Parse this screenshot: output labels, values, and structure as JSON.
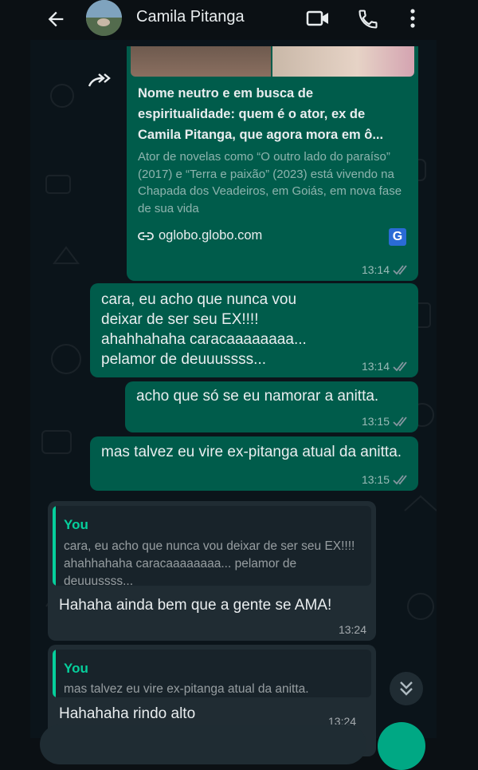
{
  "header": {
    "contact_name": "Camila Pitanga"
  },
  "messages": {
    "link": {
      "title": "Nome neutro e em busca de espiritualidade: quem é o ator, ex de Camila Pitanga, que agora mora em ô...",
      "description": "Ator de novelas como “O outro lado do paraíso” (2017) e “Terra e paixão” (2023) está vivendo na Chapada dos Veadeiros, em Goiás, em nova fase de sua vida",
      "domain": "oglobo.globo.com",
      "badge": "G",
      "time": "13:14"
    },
    "m1": {
      "text": "cara, eu acho que nunca vou deixar de ser seu EX!!!! ahahhahaha caracaaaaaaaa... pelamor de deuuussss...",
      "time": "13:14"
    },
    "m2": {
      "text": "acho que só se eu namorar a anitta.",
      "time": "13:15"
    },
    "m3": {
      "text": "mas talvez eu vire ex-pitanga atual da anitta.",
      "time": "13:15"
    },
    "r1": {
      "quote_author": "You",
      "quote_text": "cara, eu acho que nunca vou deixar de ser seu EX!!!! ahahhahaha caracaaaaaaaa... pelamor de deuuussss...",
      "text": "Hahaha ainda bem que a gente se AMA!",
      "time": "13:24"
    },
    "r2": {
      "quote_author": "You",
      "quote_text": "mas talvez eu vire ex-pitanga atual da anitta.",
      "text": "Hahahaha rindo alto",
      "time": "13:24"
    }
  },
  "colors": {
    "outgoing_bubble": "#005c4b",
    "incoming_bubble": "#202c33",
    "quote_accent": "#06cf9c",
    "ticks": "#8696a0"
  },
  "icons": [
    "back-arrow-icon",
    "video-call-icon",
    "phone-icon",
    "more-vert-icon",
    "forward-icon",
    "link-icon",
    "double-check-icon",
    "chevron-double-down-icon"
  ]
}
